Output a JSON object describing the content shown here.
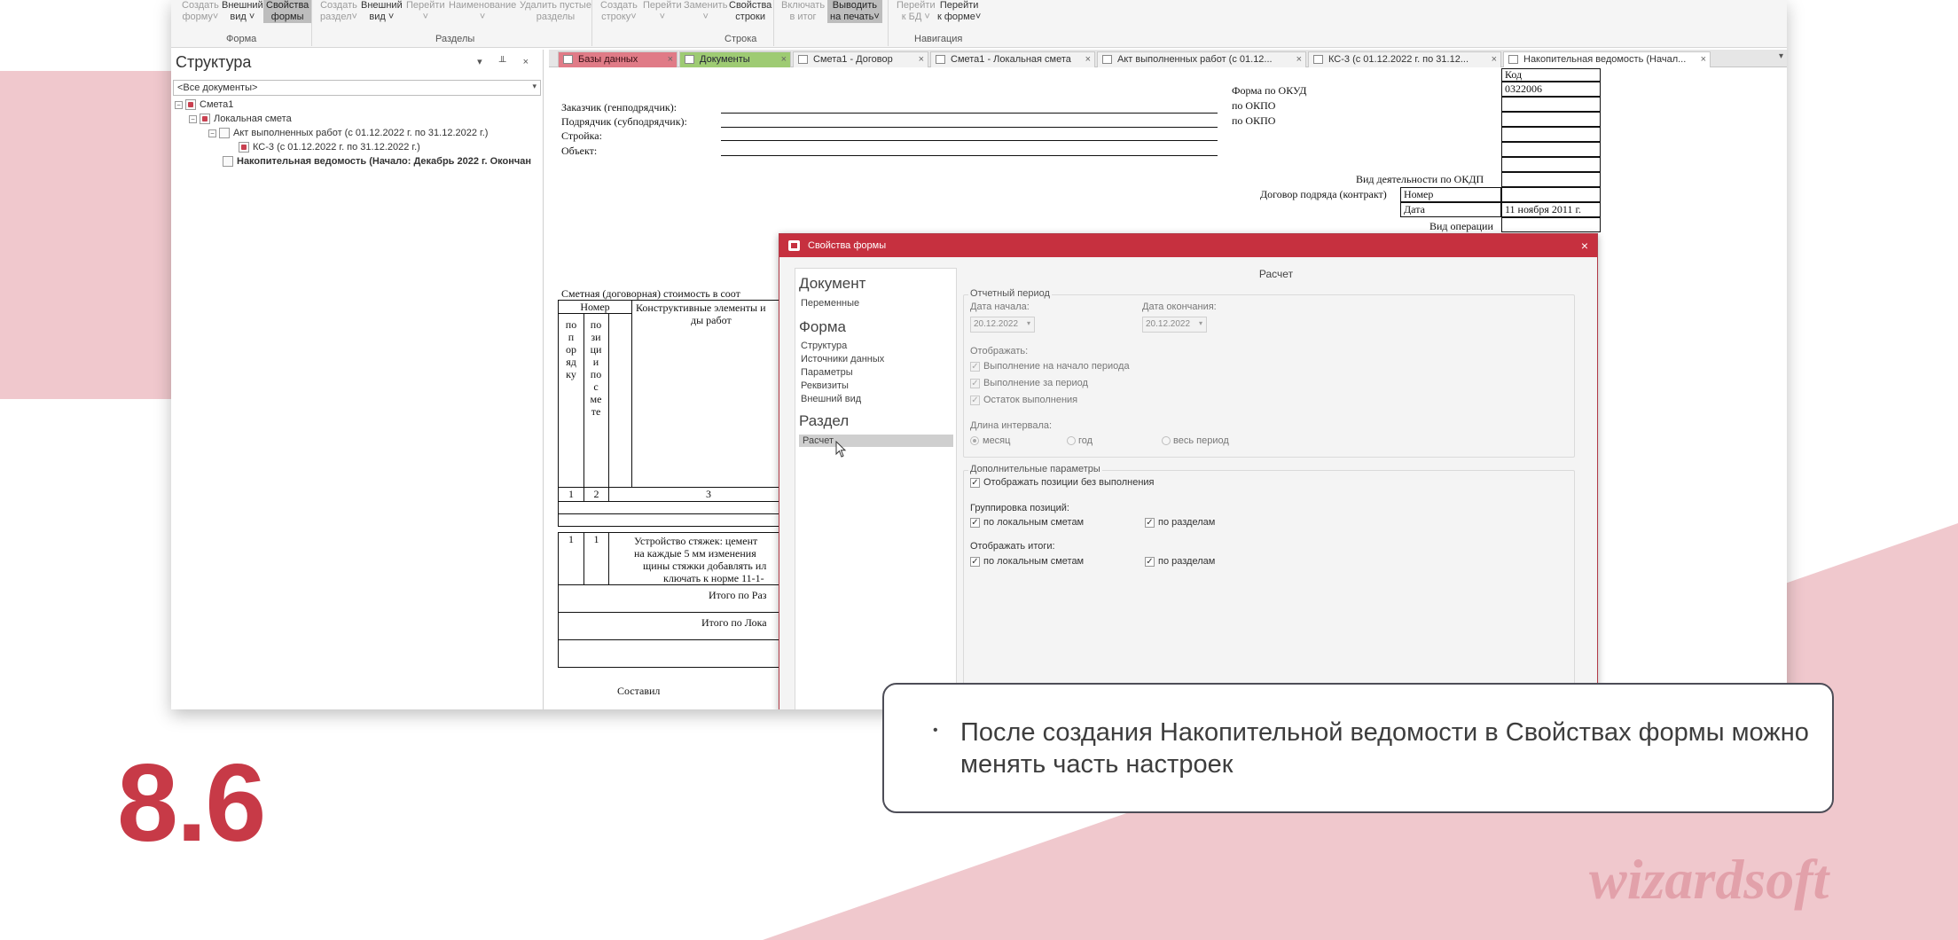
{
  "ribbon": {
    "buttons": [
      {
        "label": "Создать\nформу˅",
        "state": "disabled"
      },
      {
        "label": "Внешний\nвид ˅",
        "state": "enabled"
      },
      {
        "label": "Свойства\nформы",
        "state": "selected"
      },
      {
        "label": "Создать\nраздел˅",
        "state": "disabled"
      },
      {
        "label": "Внешний\nвид ˅",
        "state": "enabled"
      },
      {
        "label": "Перейти\n˅",
        "state": "disabled"
      },
      {
        "label": "Наименование\n˅",
        "state": "disabled"
      },
      {
        "label": "Удалить пустые\nразделы",
        "state": "disabled"
      },
      {
        "label": "Создать\nстроку˅",
        "state": "disabled"
      },
      {
        "label": "Перейти\n˅",
        "state": "disabled"
      },
      {
        "label": "Заменить\n˅",
        "state": "disabled"
      },
      {
        "label": "Свойства\nстроки",
        "state": "enabled"
      },
      {
        "label": "Включать\nв итог",
        "state": "disabled"
      },
      {
        "label": "Выводить\nна печать˅",
        "state": "selected"
      },
      {
        "label": "Перейти\nк БД ˅",
        "state": "disabled"
      },
      {
        "label": "Перейти\nк форме˅",
        "state": "enabled"
      }
    ],
    "groups": [
      "Форма",
      "Разделы",
      "Строка",
      "Навигация"
    ]
  },
  "structure": {
    "title": "Структура",
    "controls": "▾ ╨ ×",
    "filter": "<Все документы>",
    "tree": [
      {
        "label": "Смета1",
        "bold": false
      },
      {
        "label": "Локальная смета",
        "bold": false
      },
      {
        "label": "Акт выполненных работ (с 01.12.2022 г. по 31.12.2022 г.)",
        "bold": false
      },
      {
        "label": "КС-3 (с 01.12.2022 г. по 31.12.2022 г.)",
        "bold": false
      },
      {
        "label": "Накопительная ведомость (Начало: Декабрь 2022 г. Окончан",
        "bold": true
      }
    ]
  },
  "tabs": [
    {
      "label": "Базы данных",
      "style": "red"
    },
    {
      "label": "Документы",
      "style": "green"
    },
    {
      "label": "Смета1 - Договор",
      "style": "normal"
    },
    {
      "label": "Смета1 - Локальная смета",
      "style": "normal"
    },
    {
      "label": "Акт выполненных работ (с 01.12...",
      "style": "normal"
    },
    {
      "label": "КС-3 (с 01.12.2022 г. по 31.12...",
      "style": "normal"
    },
    {
      "label": "Накопительная ведомость (Начал...",
      "style": "active"
    }
  ],
  "document": {
    "kod": "Код",
    "okud_label": "Форма по ОКУД",
    "okud_value": "0322006",
    "okpo1": "по ОКПО",
    "okpo2": "по ОКПО",
    "zakazchik": "Заказчик (генподрядчик):",
    "podryadchik": "Подрядчик (субподрядчик):",
    "stroika": "Стройка:",
    "obekt": "Объект:",
    "okdp": "Вид деятельности по ОКДП",
    "dogovor": "Договор подряда (контракт)",
    "nomer": "Номер",
    "data": "Дата",
    "data_value": "11 ноября 2011 г.",
    "vid_operacii": "Вид операции",
    "smetnaya": "Сметная (договорная) стоимость в соот",
    "col_nomer": "Номер",
    "col_po_poryadku": "по\nп\nор\nяд\nку",
    "col_po_pozicii": "по\nзи\nци\nи\nпо\nс\nме\nте",
    "col_konstr": "Конструктивные элементы и",
    "col_konstr2": "ды работ",
    "num1": "1",
    "num2": "2",
    "num3": "3",
    "row1_a": "1",
    "row1_b": "1",
    "row1_text1": "Устройство стяжек: цемент",
    "row1_text2": "на каждые 5 мм изменения",
    "row1_text3": "щины стяжки добавлять ил",
    "row1_text4": "ключать к норме 11-1-",
    "itogo_razd": "Итого по Раз",
    "itogo_lok": "Итого по Лока",
    "sostavil": "Составил"
  },
  "dialog": {
    "title": "Свойства формы",
    "nav": {
      "h_document": "Документ",
      "peremennye": "Переменные",
      "h_forma": "Форма",
      "items_forma": [
        "Структура",
        "Источники данных",
        "Параметры",
        "Реквизиты",
        "Внешний вид"
      ],
      "h_razdel": "Раздел",
      "raschet": "Расчет"
    },
    "main": {
      "title": "Расчет",
      "period_group": "Отчетный период",
      "start_label": "Дата начала:",
      "start_value": "20.12.2022",
      "end_label": "Дата окончания:",
      "end_value": "20.12.2022",
      "display_label": "Отображать:",
      "display_opts": [
        "Выполнение на начало периода",
        "Выполнение за период",
        "Остаток выполнения"
      ],
      "interval_label": "Длина интервала:",
      "interval_opts": [
        "месяц",
        "год",
        "весь период"
      ],
      "extra_group": "Дополнительные параметры",
      "show_no_exec": "Отображать позиции без выполнения",
      "grouping_label": "Группировка позиций:",
      "totals_label": "Отображать итоги:",
      "opt_local": "по локальным сметам",
      "opt_sections": "по разделам"
    }
  },
  "callout": {
    "bullet": "•",
    "text": "После создания Накопительной ведомости в Свойствах формы можно менять часть настроек"
  },
  "slide_number": "8.6",
  "logo": "wizardsoft",
  "colors": {
    "accent": "#c73a47",
    "pink": "#f0c8cd",
    "tab_red": "#e07b87",
    "tab_green": "#9ecb73",
    "dialog_title": "#c6303f"
  }
}
